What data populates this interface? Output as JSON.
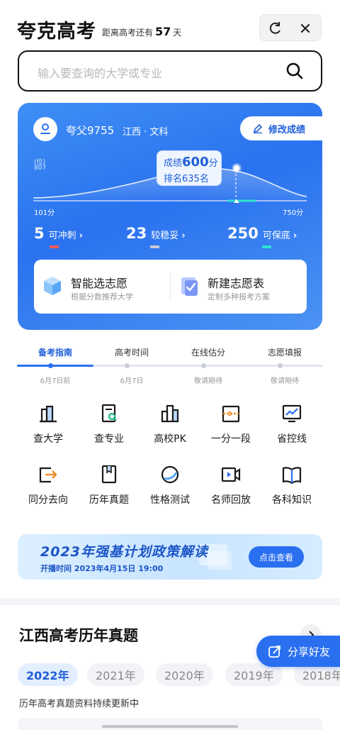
{
  "header": {
    "app_title": "夸克高考",
    "countdown_prefix": "距离高考还有",
    "countdown_days": "57",
    "countdown_suffix": "天"
  },
  "search": {
    "placeholder": "输入要查询的大学或专业"
  },
  "score_card": {
    "user_name": "夸父9755",
    "region": "江西 · 文科",
    "edit_label": "修改成绩",
    "y_axis_unit": "(位)",
    "y_axis_max": "807",
    "x_min_label": "101分",
    "x_max_label": "750分",
    "score_prefix": "成绩",
    "score_value": "600",
    "score_suffix": "分",
    "rank_text": "排名635名",
    "stats": [
      {
        "num": "5",
        "label": "可冲刺",
        "color": "#ff5a5a"
      },
      {
        "num": "23",
        "label": "较稳妥",
        "color": "#c9cdd6"
      },
      {
        "num": "250",
        "label": "可保底",
        "color": "#2fe3d0"
      }
    ],
    "features": [
      {
        "title": "智能选志愿",
        "subtitle": "根据分数推荐大学"
      },
      {
        "title": "新建志愿表",
        "subtitle": "定制多种报考方案"
      }
    ]
  },
  "timeline": [
    {
      "label": "备考指南",
      "date": "6月7日前",
      "active": true
    },
    {
      "label": "高考时间",
      "date": "6月7日",
      "active": false
    },
    {
      "label": "在线估分",
      "date": "敬请期待",
      "active": false
    },
    {
      "label": "志愿填报",
      "date": "敬请期待",
      "active": false
    }
  ],
  "tools": [
    {
      "label": "查大学",
      "icon": "university-icon"
    },
    {
      "label": "查专业",
      "icon": "major-search-icon"
    },
    {
      "label": "高校PK",
      "icon": "compare-icon"
    },
    {
      "label": "一分一段",
      "icon": "score-segment-icon"
    },
    {
      "label": "省控线",
      "icon": "control-line-icon"
    },
    {
      "label": "同分去向",
      "icon": "same-score-icon"
    },
    {
      "label": "历年真题",
      "icon": "past-exams-icon"
    },
    {
      "label": "性格测试",
      "icon": "personality-test-icon"
    },
    {
      "label": "名师回放",
      "icon": "video-replay-icon"
    },
    {
      "label": "各科知识",
      "icon": "book-icon"
    }
  ],
  "banner": {
    "title": "2023年强基计划政策解读",
    "time_label": "开播时间",
    "time_value": "2023年4月15日 19:00",
    "button": "点击查看"
  },
  "past_exams": {
    "title": "江西高考历年真题",
    "years": [
      "2022年",
      "2021年",
      "2020年",
      "2019年",
      "2018年"
    ],
    "selected_year": "2022年",
    "note": "历年高考真题资料持续更新中"
  },
  "share": {
    "label": "分享好友"
  },
  "colors": {
    "primary": "#2a6ff0",
    "card_gradient_start": "#3f8ff5",
    "card_gradient_end": "#4c93f3"
  }
}
